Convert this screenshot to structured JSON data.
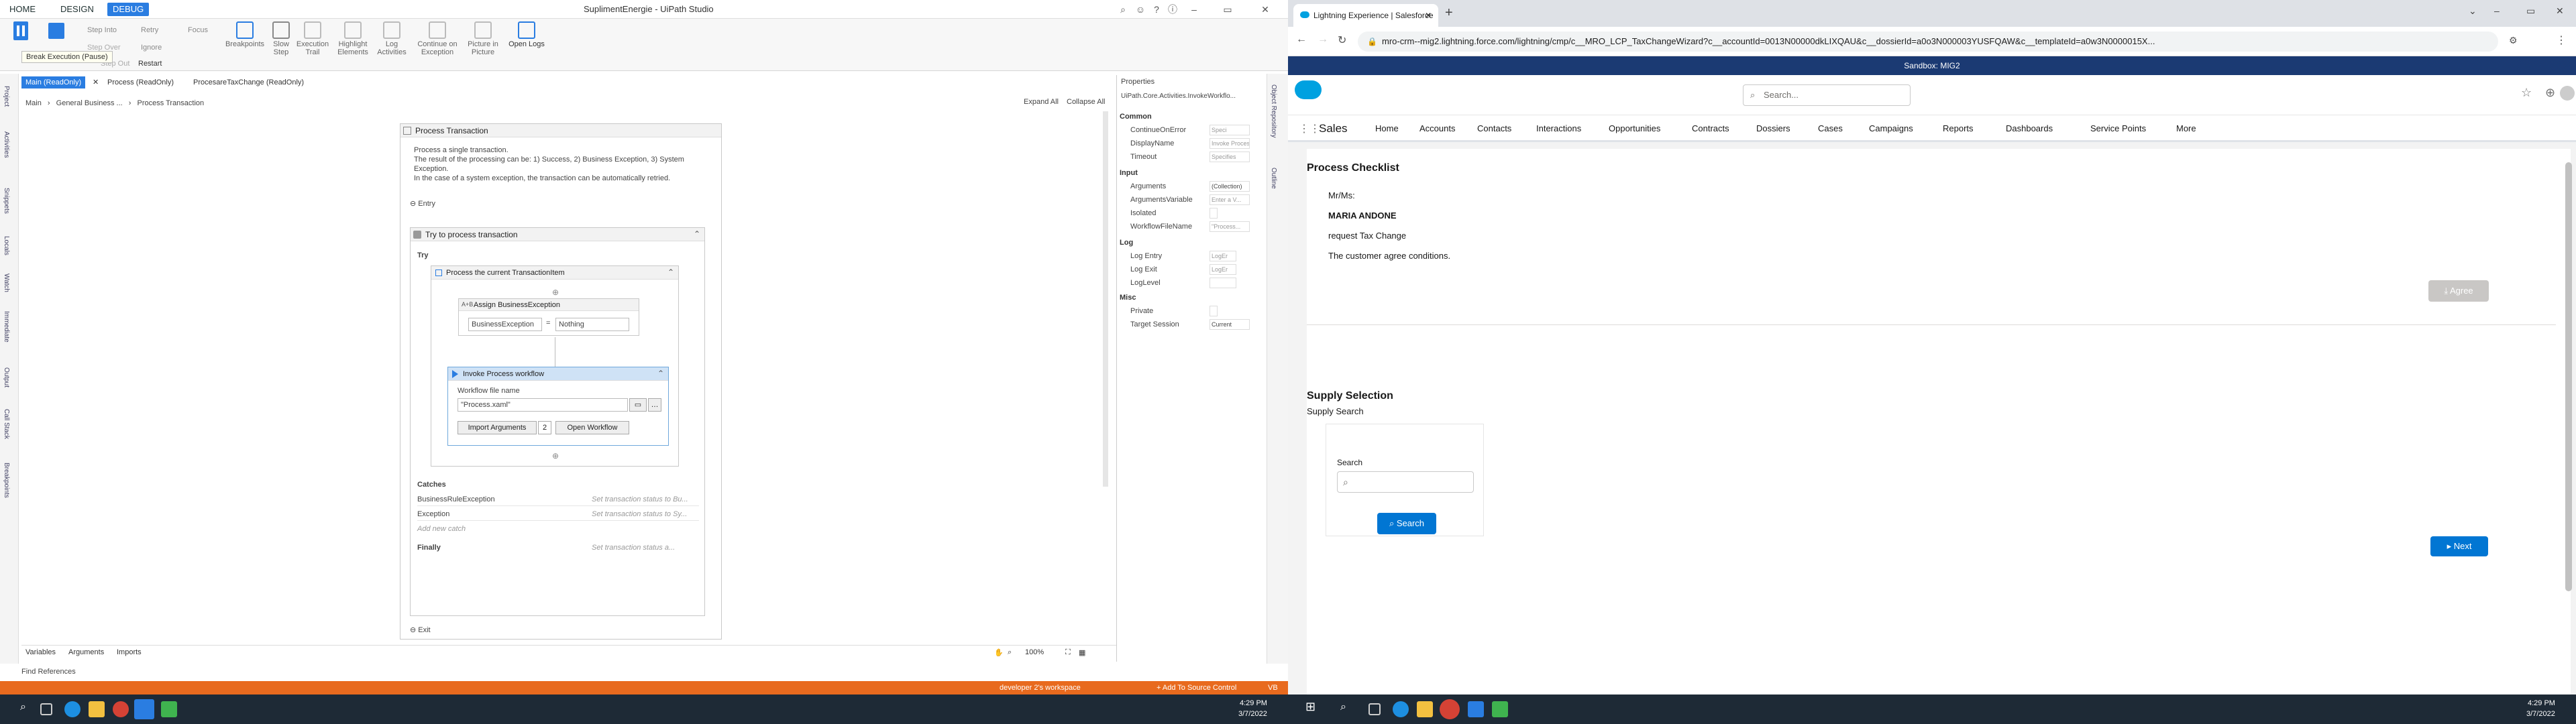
{
  "studio": {
    "window_title": "SuplimentEnergie - UiPath Studio",
    "tabs": [
      "HOME",
      "DESIGN",
      "DEBUG"
    ],
    "active_tab": "DEBUG",
    "ribbon": {
      "step_into": "Step Into",
      "step_over": "Step Over",
      "step_out": "Step Out",
      "retry": "Retry",
      "ignore": "Ignore",
      "restart": "Restart",
      "focus": "Focus",
      "breakpoints": "Breakpoints",
      "slow_step": "Slow Step",
      "execution_trail": "Execution Trail",
      "highlight_elements": "Highlight Elements",
      "log_activities": "Log Activities",
      "continue_on_exception": "Continue on Exception",
      "picture_in_picture": "Picture in Picture",
      "open_logs": "Open Logs",
      "tooltip": "Break Execution (Pause)"
    },
    "doc_tabs": [
      "Main (ReadOnly)",
      "Process (ReadOnly)",
      "ProcesareTaxChange (ReadOnly)"
    ],
    "left_panels": [
      "Project",
      "Activities",
      "Snippets",
      "Locals",
      "Watch",
      "Immediate",
      "Output",
      "Call Stack",
      "Breakpoints"
    ],
    "right_panels": [
      "Object Repository",
      "Outline"
    ],
    "breadcrumb": [
      "Main",
      "General Business ...",
      "Process Transaction"
    ],
    "expand_all": "Expand All",
    "collapse_all": "Collapse All",
    "process_transaction": {
      "title": "Process Transaction",
      "annotation_1": "Process a single transaction.",
      "annotation_2": "The result of the processing can be: 1) Success, 2) Business Exception, 3) System Exception.",
      "annotation_3": "In the case of a system exception, the transaction can be automatically retried.",
      "entry": "Entry",
      "exit": "Exit"
    },
    "try_catch": {
      "title": "Try to process transaction",
      "try_label": "Try",
      "catches_label": "Catches",
      "finally_label": "Finally",
      "catches": [
        {
          "exception": "BusinessRuleException",
          "action": "Set transaction status to Bu..."
        },
        {
          "exception": "Exception",
          "action": "Set transaction status to Sy..."
        }
      ],
      "add_catch": "Add new catch",
      "finally_action": "Set transaction status a..."
    },
    "sequence": {
      "title": "Process the current TransactionItem"
    },
    "assign": {
      "title": "Assign BusinessException",
      "left": "BusinessException",
      "eq": "=",
      "right": "Nothing"
    },
    "invoke": {
      "title": "Invoke Process workflow",
      "file_label": "Workflow file name",
      "file_value": "\"Process.xaml\"",
      "import_args": "Import Arguments",
      "args_count": "2",
      "open_workflow": "Open Workflow"
    },
    "properties": {
      "title": "Properties",
      "activity": "UiPath.Core.Activities.InvokeWorkflo...",
      "sections": {
        "common": "Common",
        "input": "Input",
        "log": "Log",
        "misc": "Misc"
      },
      "rows": {
        "continue_on_error": {
          "k": "ContinueOnError",
          "v": "Speci"
        },
        "display_name": {
          "k": "DisplayName",
          "v": "Invoke Process"
        },
        "timeout": {
          "k": "Timeout",
          "v": "Specifies"
        },
        "arguments": {
          "k": "Arguments",
          "v": "(Collection)"
        },
        "arguments_variable": {
          "k": "ArgumentsVariable",
          "v": "Enter a V..."
        },
        "isolated": {
          "k": "Isolated",
          "v": ""
        },
        "workflow_file_name": {
          "k": "WorkflowFileName",
          "v": "\"Process..."
        },
        "log_entry": {
          "k": "Log Entry",
          "v": "LogEr"
        },
        "log_exit": {
          "k": "Log Exit",
          "v": "LogEr"
        },
        "log_level": {
          "k": "LogLevel",
          "v": ""
        },
        "private": {
          "k": "Private",
          "v": ""
        },
        "target_session": {
          "k": "Target Session",
          "v": "Current"
        }
      }
    },
    "bottom_tabs": [
      "Variables",
      "Arguments",
      "Imports"
    ],
    "find_references": "Find References",
    "zoom": "100%",
    "status": {
      "workspace": "developer 2's workspace",
      "source_control": "+ Add To Source Control",
      "vb": "VB"
    },
    "clock_time": "4:29 PM",
    "clock_date": "3/7/2022"
  },
  "browser": {
    "tab_title": "Lightning Experience | Salesforce",
    "url": "mro-crm--mig2.lightning.force.com/lightning/cmp/c__MRO_LCP_TaxChangeWizard?c__accountId=0013N00000dkLIXQAU&c__dossierId=a0o3N000003YUSFQAW&c__templateId=a0w3N0000015X...",
    "sandbox_banner": "Sandbox: MIG2",
    "search_placeholder": "Search...",
    "app_name": "Sales",
    "nav": [
      "Home",
      "Accounts",
      "Contacts",
      "Interactions",
      "Opportunities",
      "Contracts",
      "Dossiers",
      "Cases",
      "Campaigns",
      "Reports",
      "Dashboards",
      "Service Points",
      "More"
    ],
    "checklist": {
      "title": "Process Checklist",
      "salutation": "Mr/Ms:",
      "customer": "MARIA ANDONE",
      "request": "request Tax Change",
      "agreement": "The customer agree conditions.",
      "agree_button": "Agree"
    },
    "supply": {
      "title": "Supply Selection",
      "subtitle": "Supply Search",
      "search_label": "Search",
      "search_button": "Search",
      "next_button": "Next"
    },
    "clock_time": "4:29 PM",
    "clock_date": "3/7/2022"
  },
  "colors": {
    "uipath_blue": "#2a7de1",
    "status_orange": "#e86a1e",
    "sf_blue": "#0176d3",
    "sandbox_navy": "#1b3a73"
  }
}
